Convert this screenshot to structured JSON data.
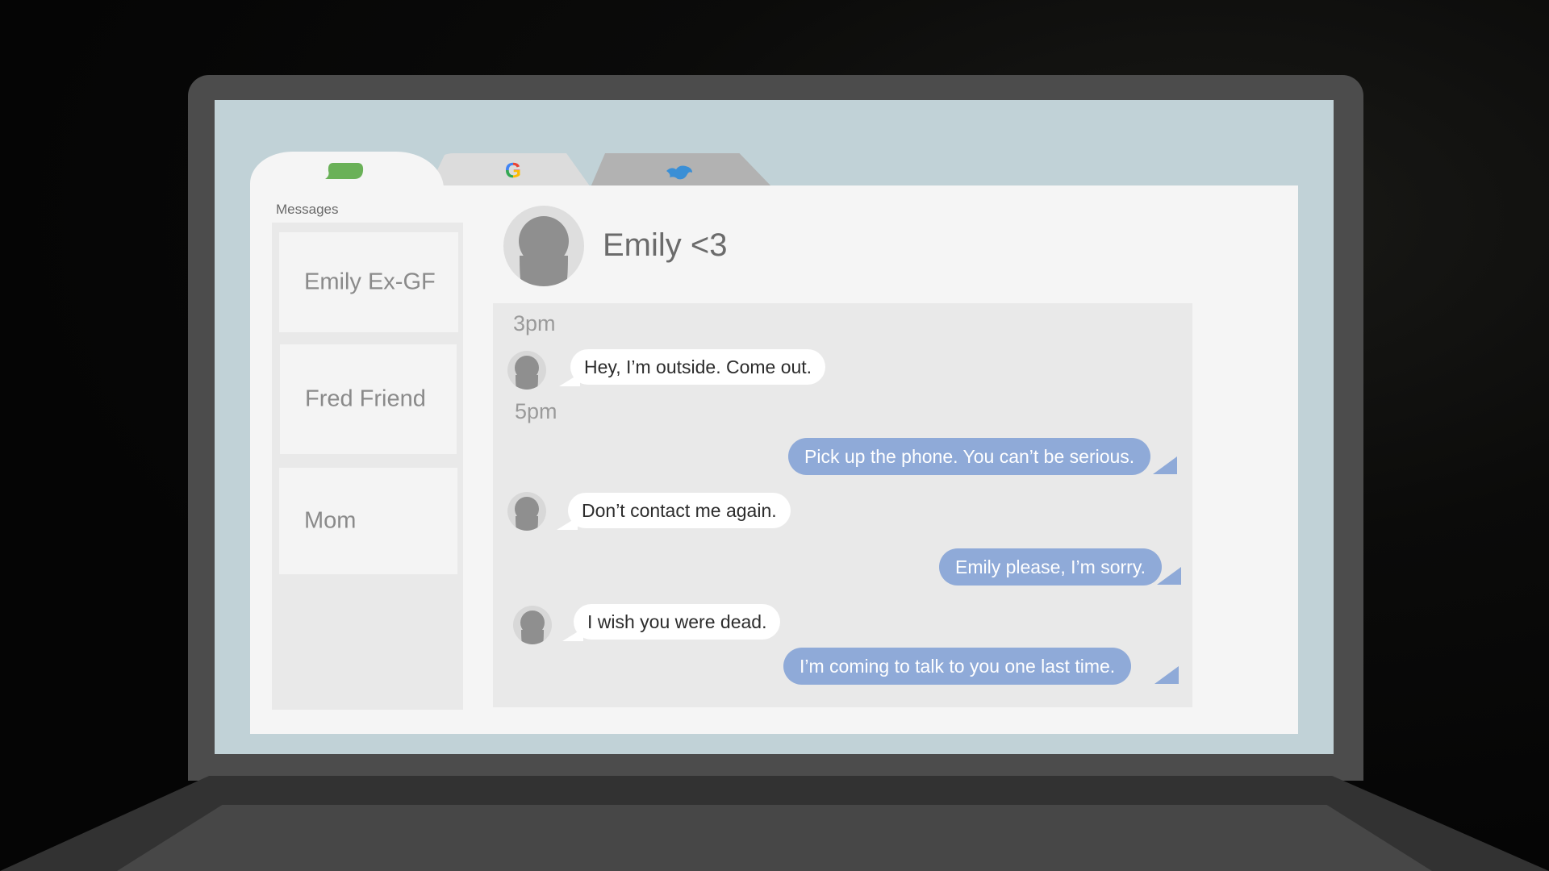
{
  "tabs": [
    {
      "name": "messages",
      "icon": "chat-bubble-icon",
      "color": "#6ab158"
    },
    {
      "name": "google",
      "icon": "google-logo-icon",
      "letter": "G"
    },
    {
      "name": "other",
      "icon": "bird-icon",
      "color": "#3a8fd6"
    }
  ],
  "sidebar": {
    "title": "Messages",
    "contacts": [
      {
        "label": "Emily Ex-GF"
      },
      {
        "label": "Fred Friend"
      },
      {
        "label": "Mom"
      }
    ]
  },
  "conversation": {
    "contact_name": "Emily <3",
    "messages": [
      {
        "type": "time",
        "text": "3pm"
      },
      {
        "type": "incoming",
        "text": "Hey, I’m outside. Come out."
      },
      {
        "type": "time",
        "text": "5pm"
      },
      {
        "type": "outgoing",
        "text": "Pick up the phone. You can’t be serious."
      },
      {
        "type": "incoming",
        "text": "Don’t contact me again."
      },
      {
        "type": "outgoing",
        "text": "Emily please, I’m sorry."
      },
      {
        "type": "incoming",
        "text": "I wish you were dead."
      },
      {
        "type": "outgoing",
        "text": "I’m coming to talk to you one last time."
      }
    ]
  },
  "colors": {
    "screen_bg": "#c1d2d7",
    "outgoing_bubble": "#8faad8",
    "incoming_bubble": "#ffffff"
  }
}
